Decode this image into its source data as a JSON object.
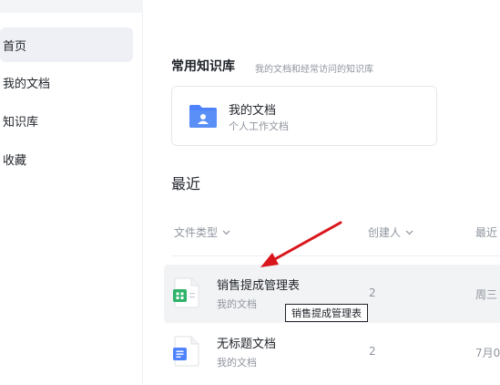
{
  "sidebar": {
    "items": [
      {
        "label": "首页",
        "active": true
      },
      {
        "label": "我的文档",
        "active": false
      },
      {
        "label": "知识库",
        "active": false
      },
      {
        "label": "收藏",
        "active": false
      }
    ]
  },
  "frequent": {
    "title": "常用知识库",
    "subtitle": "我的文档和经常访问的知识库",
    "card": {
      "name": "我的文档",
      "desc": "个人工作文档"
    }
  },
  "recent": {
    "title": "最近",
    "columns": {
      "file_type": "文件类型",
      "creator": "创建人",
      "recent": "最近"
    },
    "rows": [
      {
        "name": "销售提成管理表",
        "location": "我的文档",
        "creator": "2",
        "recent": "周三",
        "icon": "spreadsheet-icon",
        "hovered": true
      },
      {
        "name": "无标题文档",
        "location": "我的文档",
        "creator": "2",
        "recent": "7月0",
        "icon": "document-icon",
        "hovered": false
      }
    ]
  },
  "tooltip": {
    "text": "销售提成管理表"
  },
  "colors": {
    "accent_blue": "#4e83fd",
    "sheet_green": "#2fb26a",
    "arrow_red": "#d9161b"
  }
}
